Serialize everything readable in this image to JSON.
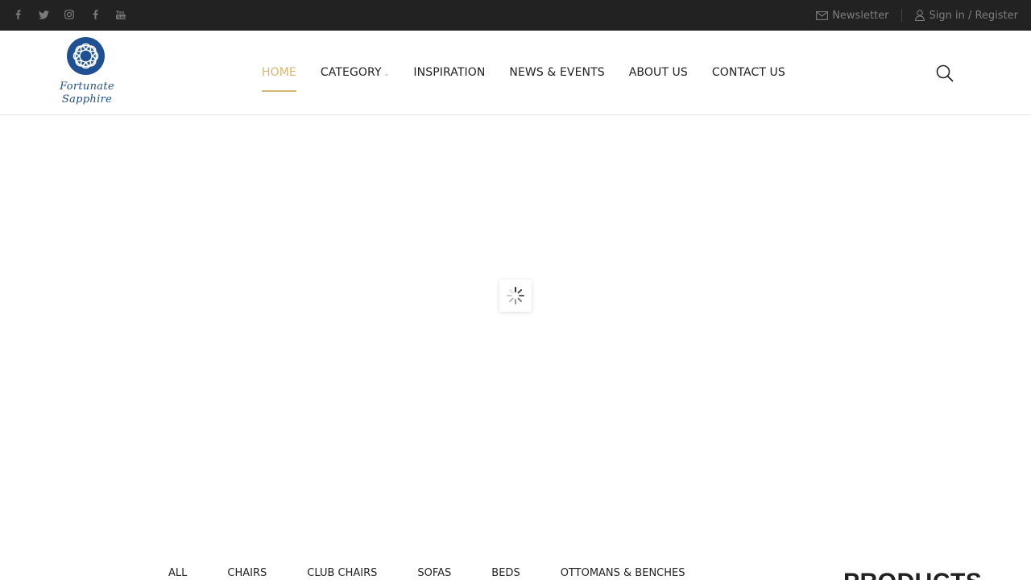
{
  "topbar": {
    "social_icons": [
      "facebook-icon",
      "twitter-icon",
      "instagram-icon",
      "facebook-icon",
      "youtube-icon"
    ],
    "newsletter_label": "Newsletter",
    "signin_label": "Sign in / Register",
    "background": "#222222",
    "text_color": "#7d7d7d"
  },
  "header": {
    "logo": {
      "line1": "Fortunate",
      "line2": "Sapphire",
      "color": "#1f5192"
    },
    "nav": [
      {
        "label": "HOME",
        "active": true
      },
      {
        "label": "CATEGORY",
        "has_dropdown": true
      },
      {
        "label": "INSPIRATION"
      },
      {
        "label": "NEWS & EVENTS"
      },
      {
        "label": "ABOUT US"
      },
      {
        "label": "CONTACT US"
      }
    ],
    "active_color": "#d8b572",
    "search_icon": "search-icon"
  },
  "main": {
    "loading": true,
    "loader_icon": "spinner-icon"
  },
  "products": {
    "filters": [
      "ALL",
      "CHAIRS",
      "CLUB CHAIRS",
      "SOFAS",
      "BEDS",
      "OTTOMANS & BENCHES"
    ],
    "title": "PRODUCTS"
  }
}
